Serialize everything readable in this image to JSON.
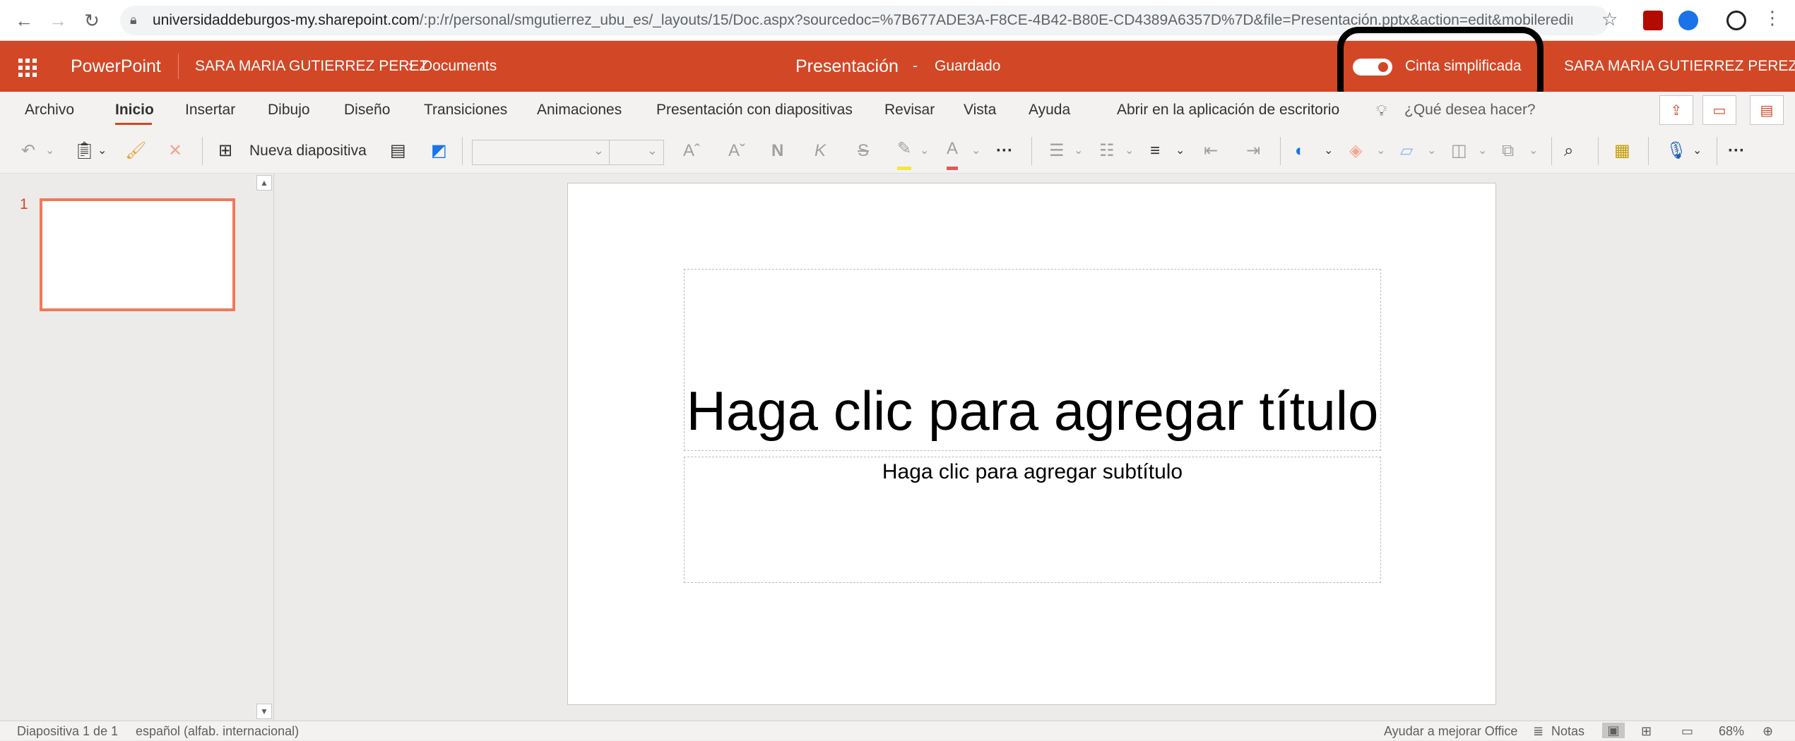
{
  "browser": {
    "url_host": "universidaddeburgos-my.sharepoint.com",
    "url_path": "/:p:/r/personal/smgutierrez_ubu_es/_layouts/15/Doc.aspx?sourcedoc=%7B677ADE3A-F8CE-4B42-B80E-CD4389A6357D%7D&file=Presentación.pptx&action=edit&mobileredirec...",
    "back_icon": "arrow-left",
    "forward_icon": "arrow-right",
    "reload_icon": "reload",
    "lock_icon": "lock",
    "star_icon": "star"
  },
  "header": {
    "app_name": "PowerPoint",
    "owner": "SARA MARIA GUTIERREZ PEREZ",
    "breadcrumb_sep": "›",
    "folder": "Documents",
    "doc_title": "Presentación",
    "title_sep": "-",
    "save_status": "Guardado",
    "toggle_label": "Cinta simplificada",
    "user": "SARA MARIA GUTIERREZ PEREZ",
    "brand_color": "#d24726"
  },
  "ribbon": {
    "tabs": [
      "Archivo",
      "Inicio",
      "Insertar",
      "Dibujo",
      "Diseño",
      "Transiciones",
      "Animaciones",
      "Presentación con diapositivas",
      "Revisar",
      "Vista",
      "Ayuda"
    ],
    "active_tab": "Inicio",
    "open_desktop": "Abrir en la aplicación de escritorio",
    "tell_me": "¿Qué desea hacer?"
  },
  "toolbar": {
    "new_slide": "Nueva diapositiva",
    "increase_font": "Aˆ",
    "decrease_font": "Aˇ",
    "bold": "N",
    "italic": "K",
    "strike": "S",
    "font_color": "A",
    "more": "···"
  },
  "thumbs": {
    "slide_number": "1"
  },
  "slide": {
    "title_placeholder": "Haga clic para agregar título",
    "subtitle_placeholder": "Haga clic para agregar subtítulo"
  },
  "status": {
    "slide_info": "Diapositiva 1 de 1",
    "language": "español (alfab. internacional)",
    "help_improve": "Ayudar a mejorar Office",
    "notes": "Notas",
    "zoom": "68%"
  }
}
